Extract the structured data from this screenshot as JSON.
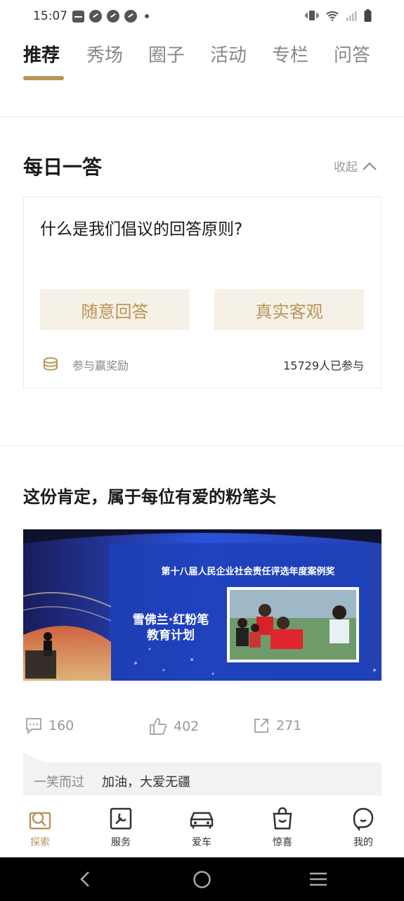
{
  "status_bar": {
    "time": "15:07"
  },
  "tabs": [
    {
      "label": "推荐",
      "active": true
    },
    {
      "label": "秀场",
      "active": false
    },
    {
      "label": "圈子",
      "active": false
    },
    {
      "label": "活动",
      "active": false
    },
    {
      "label": "专栏",
      "active": false
    },
    {
      "label": "问答",
      "active": false
    }
  ],
  "daily_answer": {
    "title": "每日一答",
    "collapse_label": "收起",
    "question": "什么是我们倡议的回答原则?",
    "option_left": "随意回答",
    "option_right": "真实客观",
    "reward_label": "参与赢奖励",
    "participants": "15729人已参与"
  },
  "article": {
    "title": "这份肯定，属于每位有爱的粉笔头",
    "image": {
      "banner_line": "第十八届人民企业社会责任评选年度案例奖",
      "program_line1": "雪佛兰·红粉笔",
      "program_line2": "教育计划"
    },
    "comments_count": "160",
    "likes_count": "402",
    "shares_count": "271",
    "top_comment": {
      "user": "一笑而过",
      "text": "加油，大爱无疆"
    }
  },
  "bottom_nav": [
    {
      "label": "探索",
      "icon": "explore-icon",
      "active": true
    },
    {
      "label": "服务",
      "icon": "service-icon",
      "active": false
    },
    {
      "label": "爱车",
      "icon": "car-icon",
      "active": false
    },
    {
      "label": "惊喜",
      "icon": "gift-bag-icon",
      "active": false
    },
    {
      "label": "我的",
      "icon": "profile-icon",
      "active": false
    }
  ],
  "colors": {
    "accent": "#b8955a",
    "accent_bg": "#f6f1e6"
  }
}
